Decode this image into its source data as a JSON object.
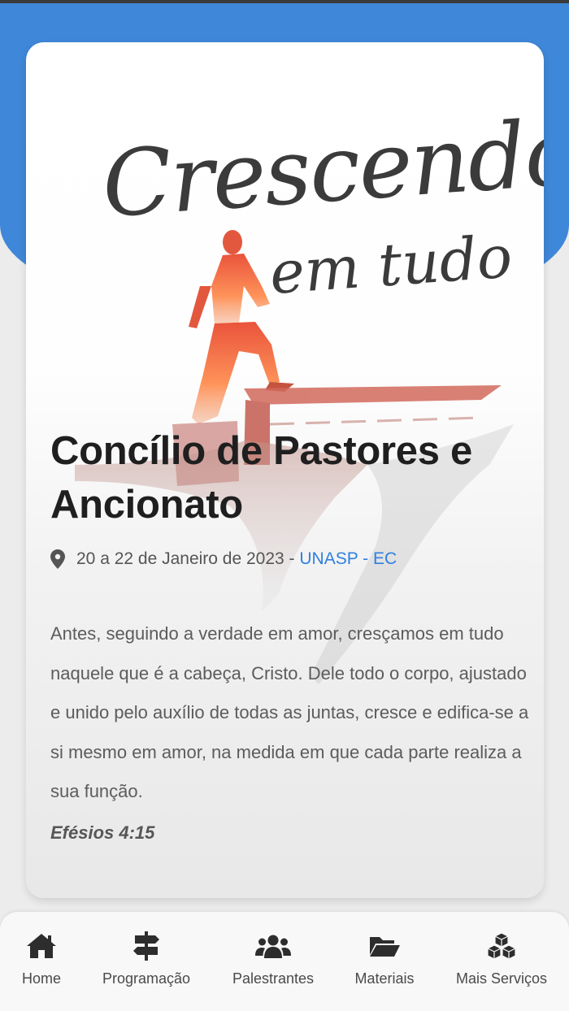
{
  "theme": {
    "accent": "#3f87d8",
    "link_color": "#2f80e0",
    "artwork_color": "#ef5a3c"
  },
  "artwork": {
    "logo_line1": "Crescendo",
    "logo_line2": "em tudo"
  },
  "event": {
    "title": "Concílio de Pastores e Ancionato",
    "date": "20 a 22 de Janeiro de 2023 - ",
    "venue": "UNASP - EC",
    "verse": "Antes, seguindo a verdade em amor, cresçamos em tudo naquele que é a cabeça, Cristo. Dele todo o corpo, ajustado e unido pelo auxílio de todas as juntas, cresce e edifica-se a si mesmo em amor, na medida em que cada parte realiza a sua função.",
    "verse_ref": "Efésios 4:15"
  },
  "nav": {
    "items": [
      {
        "label": "Home",
        "icon": "home-icon"
      },
      {
        "label": "Programação",
        "icon": "signpost-icon"
      },
      {
        "label": "Palestrantes",
        "icon": "users-icon"
      },
      {
        "label": "Materiais",
        "icon": "folder-open-icon"
      },
      {
        "label": "Mais Serviços",
        "icon": "cubes-icon"
      }
    ]
  }
}
